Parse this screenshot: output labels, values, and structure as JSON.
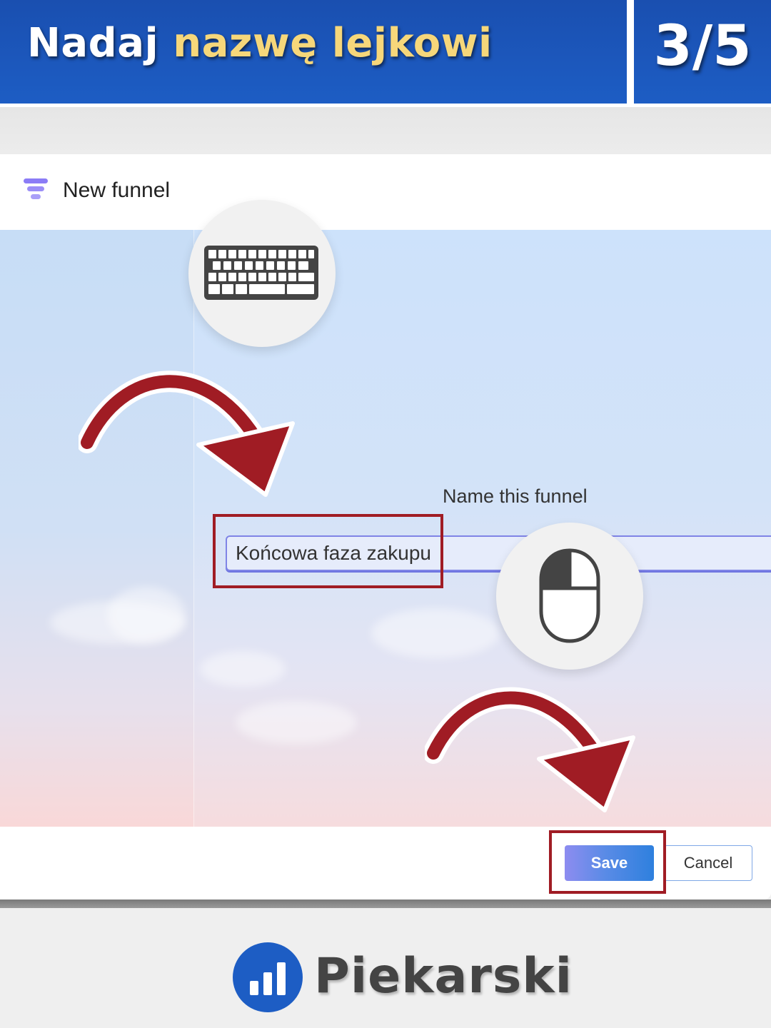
{
  "header": {
    "title_part1": "Nadaj ",
    "title_part2": "nazwę lejkowi",
    "step": "3/5",
    "accent_color": "#f6d77a",
    "banner_color": "#1d5dc4"
  },
  "dialog": {
    "title": "New funnel",
    "title_icon": "funnel-icon",
    "field_label": "Name this funnel",
    "input_value": "Końcowa faza zakupu",
    "save_label": "Save",
    "cancel_label": "Cancel"
  },
  "annotations": {
    "keyboard_icon": "keyboard-icon",
    "mouse_icon": "mouse-left-click-icon",
    "arrow_icon": "curved-arrow-icon",
    "highlight_color": "#a01c24"
  },
  "footer": {
    "brand_name": "Piekarski",
    "brand_icon": "bar-chart-icon"
  }
}
